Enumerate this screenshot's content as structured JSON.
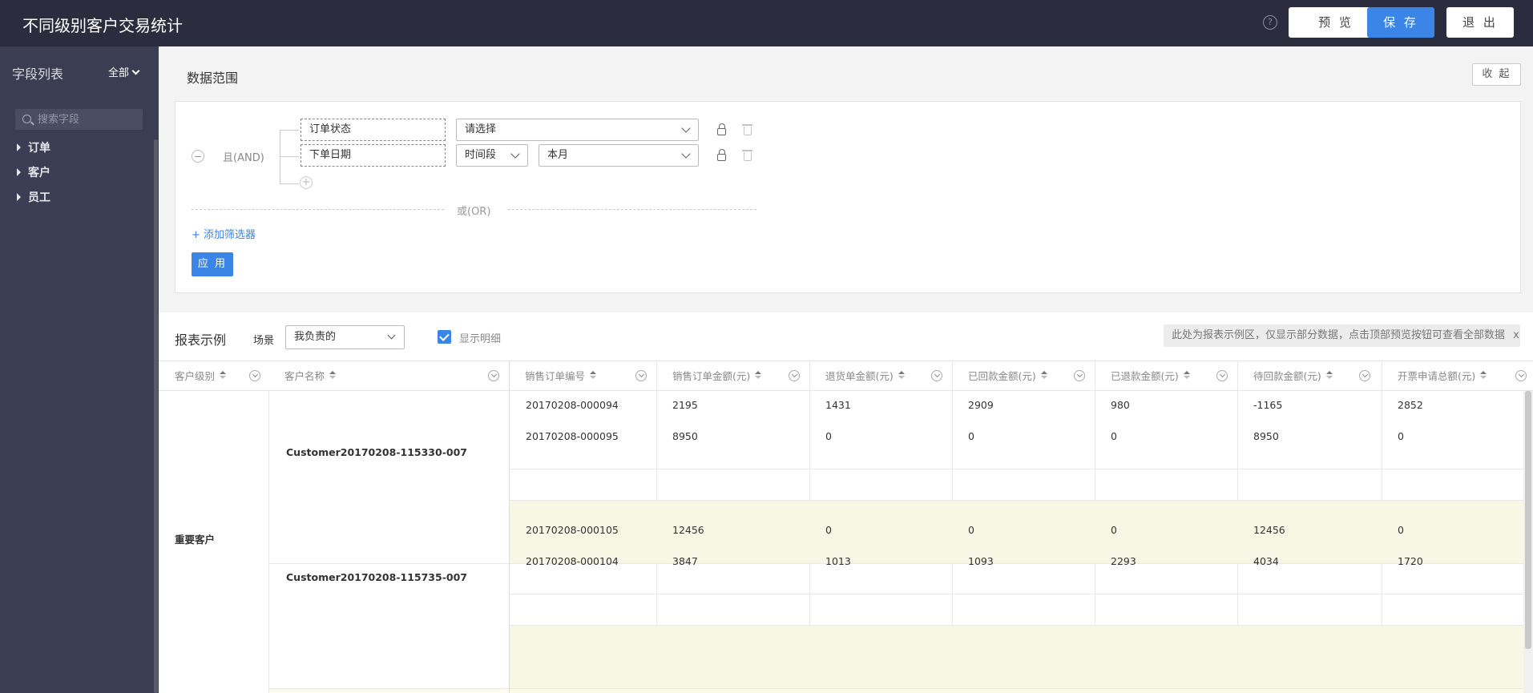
{
  "header": {
    "title": "不同级别客户交易统计",
    "help_label": "?",
    "preview_label": "预 览",
    "save_label": "保 存",
    "exit_label": "退 出"
  },
  "sidebar": {
    "title": "字段列表",
    "filter_label": "全部",
    "search_placeholder": "搜索字段",
    "items": [
      {
        "label": "订单"
      },
      {
        "label": "客户"
      },
      {
        "label": "员工"
      }
    ]
  },
  "data_range": {
    "title": "数据范围",
    "collapse_label": "收 起",
    "logic_label": "且(AND)",
    "conditions": [
      {
        "field": "订单状态",
        "operator": "请选择"
      },
      {
        "field": "下单日期",
        "operator": "时间段",
        "value": "本月"
      }
    ],
    "or_label": "或(OR)",
    "add_filter_label": "+ 添加筛选器",
    "apply_label": "应 用"
  },
  "report": {
    "title": "报表示例",
    "scene_label": "场景",
    "scene_value": "我负责的",
    "show_detail_label": "显示明细",
    "notice": "此处为报表示例区，仅显示部分数据，点击顶部预览按钮可查看全部数据",
    "notice_close": "x",
    "columns": [
      "客户级别",
      "客户名称",
      "销售订单编号",
      "销售订单金额(元)",
      "退货单金额(元)",
      "已回款金额(元)",
      "已退款金额(元)",
      "待回款金额(元)",
      "开票申请总额(元)"
    ],
    "level": "重要客户",
    "customers": [
      {
        "name": "Customer20170208-115330-007",
        "rows": [
          [
            "20170208-000094",
            "2195",
            "1431",
            "2909",
            "980",
            "-1165",
            "2852"
          ],
          [
            "20170208-000095",
            "8950",
            "0",
            "0",
            "0",
            "8950",
            "0"
          ]
        ]
      },
      {
        "name": "Customer20170208-115735-007",
        "rows": [
          [
            "20170208-000105",
            "12456",
            "0",
            "0",
            "0",
            "12456",
            "0"
          ],
          [
            "20170208-000104",
            "3847",
            "1013",
            "1093",
            "2293",
            "4034",
            "1720"
          ]
        ]
      }
    ]
  },
  "colors": {
    "header_bg": "#2b2d3f",
    "sidebar_bg": "#3b3e52",
    "accent": "#3a85e5",
    "subtotal_band": "#f8f6e5"
  }
}
